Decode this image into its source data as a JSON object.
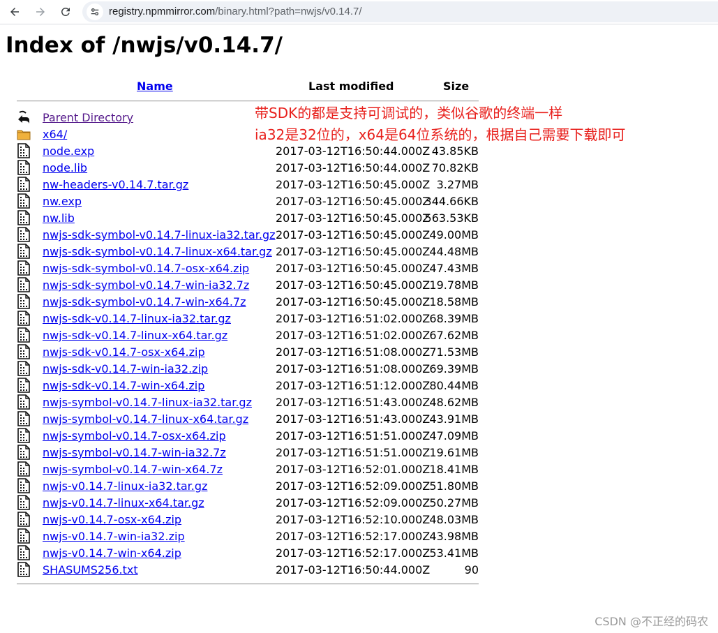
{
  "browser": {
    "url_host": "registry.npmmirror.com",
    "url_path": "/binary.html?path=nwjs/v0.14.7/"
  },
  "page": {
    "title": "Index of /nwjs/v0.14.7/",
    "columns": {
      "name": "Name",
      "modified": "Last modified",
      "size": "Size"
    }
  },
  "annotations": {
    "line1": "带SDK的都是支持可调试的，类似谷歌的终端一样",
    "line2": "ia32是32位的，x64是64位系统的，根据自己需要下载即可",
    "color": "#e8211d"
  },
  "entries": [
    {
      "name": "Parent Directory",
      "modified": "",
      "size": "",
      "icon": "back-icon"
    },
    {
      "name": "x64/",
      "modified": "",
      "size": "",
      "icon": "folder-icon"
    },
    {
      "name": "node.exp",
      "modified": "2017-03-12T16:50:44.000Z",
      "size": "43.85KB",
      "icon": "file-icon"
    },
    {
      "name": "node.lib",
      "modified": "2017-03-12T16:50:44.000Z",
      "size": "70.82KB",
      "icon": "file-icon"
    },
    {
      "name": "nw-headers-v0.14.7.tar.gz",
      "modified": "2017-03-12T16:50:45.000Z",
      "size": "3.27MB",
      "icon": "file-icon"
    },
    {
      "name": "nw.exp",
      "modified": "2017-03-12T16:50:45.000Z",
      "size": "344.66KB",
      "icon": "file-icon"
    },
    {
      "name": "nw.lib",
      "modified": "2017-03-12T16:50:45.000Z",
      "size": "563.53KB",
      "icon": "file-icon"
    },
    {
      "name": "nwjs-sdk-symbol-v0.14.7-linux-ia32.tar.gz",
      "modified": "2017-03-12T16:50:45.000Z",
      "size": "49.00MB",
      "icon": "file-icon"
    },
    {
      "name": "nwjs-sdk-symbol-v0.14.7-linux-x64.tar.gz",
      "modified": "2017-03-12T16:50:45.000Z",
      "size": "44.48MB",
      "icon": "file-icon"
    },
    {
      "name": "nwjs-sdk-symbol-v0.14.7-osx-x64.zip",
      "modified": "2017-03-12T16:50:45.000Z",
      "size": "47.43MB",
      "icon": "file-icon"
    },
    {
      "name": "nwjs-sdk-symbol-v0.14.7-win-ia32.7z",
      "modified": "2017-03-12T16:50:45.000Z",
      "size": "19.78MB",
      "icon": "file-icon"
    },
    {
      "name": "nwjs-sdk-symbol-v0.14.7-win-x64.7z",
      "modified": "2017-03-12T16:50:45.000Z",
      "size": "18.58MB",
      "icon": "file-icon"
    },
    {
      "name": "nwjs-sdk-v0.14.7-linux-ia32.tar.gz",
      "modified": "2017-03-12T16:51:02.000Z",
      "size": "68.39MB",
      "icon": "file-icon"
    },
    {
      "name": "nwjs-sdk-v0.14.7-linux-x64.tar.gz",
      "modified": "2017-03-12T16:51:02.000Z",
      "size": "67.62MB",
      "icon": "file-icon"
    },
    {
      "name": "nwjs-sdk-v0.14.7-osx-x64.zip",
      "modified": "2017-03-12T16:51:08.000Z",
      "size": "71.53MB",
      "icon": "file-icon"
    },
    {
      "name": "nwjs-sdk-v0.14.7-win-ia32.zip",
      "modified": "2017-03-12T16:51:08.000Z",
      "size": "69.39MB",
      "icon": "file-icon"
    },
    {
      "name": "nwjs-sdk-v0.14.7-win-x64.zip",
      "modified": "2017-03-12T16:51:12.000Z",
      "size": "80.44MB",
      "icon": "file-icon"
    },
    {
      "name": "nwjs-symbol-v0.14.7-linux-ia32.tar.gz",
      "modified": "2017-03-12T16:51:43.000Z",
      "size": "48.62MB",
      "icon": "file-icon"
    },
    {
      "name": "nwjs-symbol-v0.14.7-linux-x64.tar.gz",
      "modified": "2017-03-12T16:51:43.000Z",
      "size": "43.91MB",
      "icon": "file-icon"
    },
    {
      "name": "nwjs-symbol-v0.14.7-osx-x64.zip",
      "modified": "2017-03-12T16:51:51.000Z",
      "size": "47.09MB",
      "icon": "file-icon"
    },
    {
      "name": "nwjs-symbol-v0.14.7-win-ia32.7z",
      "modified": "2017-03-12T16:51:51.000Z",
      "size": "19.61MB",
      "icon": "file-icon"
    },
    {
      "name": "nwjs-symbol-v0.14.7-win-x64.7z",
      "modified": "2017-03-12T16:52:01.000Z",
      "size": "18.41MB",
      "icon": "file-icon"
    },
    {
      "name": "nwjs-v0.14.7-linux-ia32.tar.gz",
      "modified": "2017-03-12T16:52:09.000Z",
      "size": "51.80MB",
      "icon": "file-icon"
    },
    {
      "name": "nwjs-v0.14.7-linux-x64.tar.gz",
      "modified": "2017-03-12T16:52:09.000Z",
      "size": "50.27MB",
      "icon": "file-icon"
    },
    {
      "name": "nwjs-v0.14.7-osx-x64.zip",
      "modified": "2017-03-12T16:52:10.000Z",
      "size": "48.03MB",
      "icon": "file-icon"
    },
    {
      "name": "nwjs-v0.14.7-win-ia32.zip",
      "modified": "2017-03-12T16:52:17.000Z",
      "size": "43.98MB",
      "icon": "file-icon"
    },
    {
      "name": "nwjs-v0.14.7-win-x64.zip",
      "modified": "2017-03-12T16:52:17.000Z",
      "size": "53.41MB",
      "icon": "file-icon"
    },
    {
      "name": "SHASUMS256.txt",
      "modified": "2017-03-12T16:50:44.000Z",
      "size": "90",
      "icon": "file-icon"
    }
  ],
  "watermark": "CSDN @不正经的码农"
}
